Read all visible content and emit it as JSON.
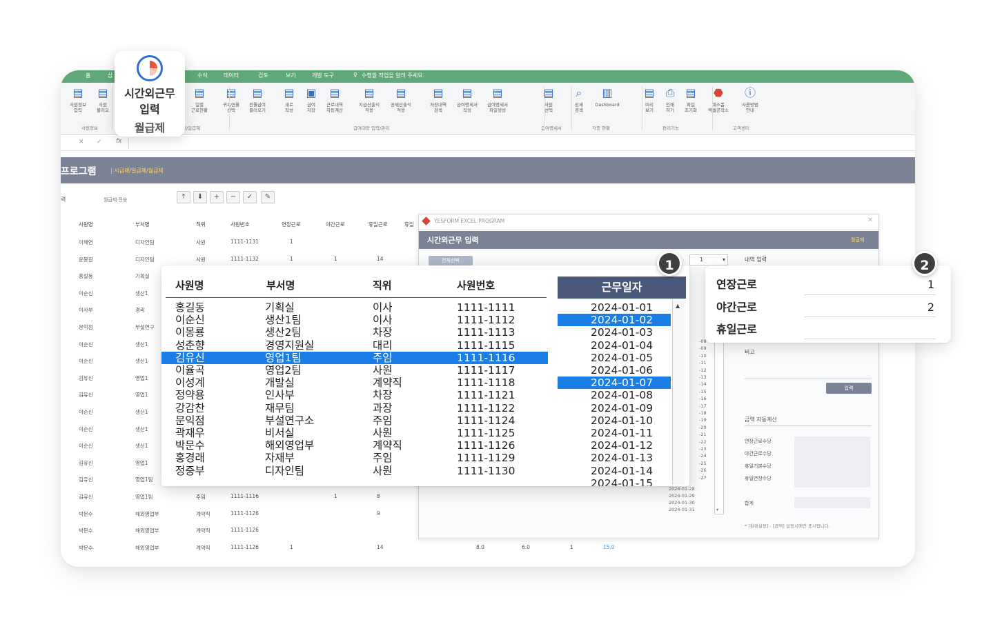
{
  "menu": {
    "items": [
      "홈",
      "삽",
      "수식",
      "데이터",
      "검토",
      "보기",
      "개발 도구"
    ],
    "search_hint": "수행할 작업을 알려 주세요."
  },
  "ribbon": {
    "buttons": [
      {
        "label": "사원정보\n입력",
        "icon": "people-icon"
      },
      {
        "label": "사원\n불러오",
        "icon": "people-load-icon"
      },
      {
        "label": "보\n",
        "icon": "doc-icon"
      },
      {
        "label": "일별\n근로현황",
        "icon": "calendar-icon"
      },
      {
        "label": "귀속연월\n선택",
        "icon": "calendar-select-icon"
      },
      {
        "label": "전월급여\n불러오기",
        "icon": "load-icon"
      },
      {
        "label": "새로\n작성",
        "icon": "new-doc-icon"
      },
      {
        "label": "급여\n저장",
        "icon": "save-icon"
      },
      {
        "label": "근로내역\n자동계산",
        "icon": "table-icon"
      },
      {
        "label": "지급산출식\n적용",
        "icon": "formula-icon"
      },
      {
        "label": "공제산출식\n적용",
        "icon": "formula2-icon"
      },
      {
        "label": "저장내역\n검색",
        "icon": "search-doc-icon"
      },
      {
        "label": "급여명세서\n작성",
        "icon": "edit-doc-icon"
      },
      {
        "label": "급여명세서\n파일생성",
        "icon": "file-gen-icon"
      },
      {
        "label": "사원\n선택",
        "icon": "user-select-icon"
      },
      {
        "label": "상세\n검색",
        "icon": "search-icon"
      },
      {
        "label": "Dashboard",
        "icon": "chart-icon"
      },
      {
        "label": "미리\n보기",
        "icon": "preview-icon"
      },
      {
        "label": "인쇄\n하기",
        "icon": "print-icon"
      },
      {
        "label": "파일\n초기화",
        "icon": "reset-icon"
      },
      {
        "label": "예스폼\n엑셀공작소",
        "icon": "yesform-icon"
      },
      {
        "label": "사용방법\n안내",
        "icon": "info-icon"
      }
    ],
    "groups": [
      "사원정보",
      "제/일급제",
      "급여대장 입력/관리",
      "급여명세서",
      "각종 현황",
      "편리기능",
      "고객센터"
    ]
  },
  "floating_card": {
    "line1": "시간외근무",
    "line2": "입력",
    "line3": "월급제"
  },
  "formula_bar": {
    "fx": "fx"
  },
  "program": {
    "title": "프로그램",
    "breadcrumb": "시급제/일급제/월급제",
    "sub_label_a": "력",
    "sub_label_b": "월급제 전용"
  },
  "sheet": {
    "headers": [
      "사원명",
      "부서명",
      "직위",
      "사원번호",
      "연장근로",
      "야간근로",
      "휴일근로",
      "휴일"
    ],
    "rows": [
      [
        "이채연",
        "디자인팀",
        "사원",
        "1111-1131",
        "1",
        "",
        ""
      ],
      [
        "윤봉길",
        "디자인팀",
        "사원",
        "1111-1132",
        "1",
        "1",
        "14"
      ],
      [
        "홍길동",
        "기획실",
        "",
        "",
        "",
        "",
        ""
      ],
      [
        "이순신",
        "생산1",
        "",
        "",
        "",
        "",
        ""
      ],
      [
        "이사부",
        "경리",
        "",
        "",
        "",
        "",
        ""
      ],
      [
        "문익점",
        "부설연구",
        "",
        "",
        "",
        "",
        ""
      ],
      [
        "이순신",
        "생산1",
        "",
        "",
        "",
        "",
        ""
      ],
      [
        "이순신",
        "생산1",
        "",
        "",
        "",
        "",
        ""
      ],
      [
        "김유신",
        "영업1",
        "",
        "",
        "",
        "",
        ""
      ],
      [
        "김유신",
        "영업1",
        "",
        "",
        "",
        "",
        ""
      ],
      [
        "이순신",
        "생산1",
        "",
        "",
        "",
        "",
        ""
      ],
      [
        "이순신",
        "생산1",
        "",
        "",
        "",
        "",
        ""
      ],
      [
        "이순신",
        "생산1",
        "",
        "",
        "",
        "",
        ""
      ],
      [
        "김유신",
        "영업1",
        "",
        "",
        "",
        "",
        ""
      ],
      [
        "김유신",
        "영업1팀",
        "",
        "",
        "",
        "",
        ""
      ],
      [
        "김유신",
        "영업1팀",
        "주임",
        "1111-1116",
        "",
        "1",
        "8"
      ],
      [
        "박문수",
        "해외영업부",
        "계약직",
        "1111-1126",
        "",
        "",
        "9"
      ],
      [
        "박문수",
        "해외영업부",
        "계약직",
        "1111-1126",
        "",
        "",
        ""
      ],
      [
        "박문수",
        "해외영업부",
        "계약직",
        "1111-1126",
        "1",
        "",
        "14"
      ]
    ],
    "last_row_extra": [
      "8.0",
      "6.0",
      "1",
      "15.0"
    ]
  },
  "dialog": {
    "app_name": "YESFORM EXCEL PROGRAM",
    "title": "시간외근무 입력",
    "mode": "월급제",
    "select_all": "전체선택",
    "input_header": "내역 입력",
    "remark_label": "비고",
    "submit_label": "입력",
    "auto_calc_label": "금액 자동계산",
    "calc_items": [
      "연장근로수당",
      "야간근로수당",
      "휴일기본수당",
      "휴일연장수당"
    ],
    "total_label": "합계",
    "footnote": "* [환경설정] - [금액] 설정시에만 표시됩니다.",
    "small_dates_tail": [
      "2024-01-28",
      "2024-01-29",
      "2024-01-30",
      "2024-01-31"
    ],
    "small_day_nums": [
      "-08",
      "-09",
      "-10",
      "-11",
      "-12",
      "-13",
      "-14",
      "-15",
      "-16",
      "-17",
      "-18",
      "-19",
      "-20",
      "-21",
      "-22",
      "-23",
      "-24",
      "-25",
      "-26",
      "-27"
    ],
    "month_value": "1"
  },
  "popup": {
    "headers": [
      "사원명",
      "부서명",
      "직위",
      "사원번호"
    ],
    "date_header": "근무일자",
    "rows": [
      {
        "name": "홍길동",
        "dept": "기획실",
        "pos": "이사",
        "id": "1111-1111"
      },
      {
        "name": "이순신",
        "dept": "생산1팀",
        "pos": "이사",
        "id": "1111-1112"
      },
      {
        "name": "이몽룡",
        "dept": "생산2팀",
        "pos": "차장",
        "id": "1111-1113"
      },
      {
        "name": "성춘향",
        "dept": "경영지원실",
        "pos": "대리",
        "id": "1111-1115"
      },
      {
        "name": "김유신",
        "dept": "영업1팀",
        "pos": "주임",
        "id": "1111-1116"
      },
      {
        "name": "이율곡",
        "dept": "영업2팀",
        "pos": "사원",
        "id": "1111-1117"
      },
      {
        "name": "이성계",
        "dept": "개발실",
        "pos": "계약직",
        "id": "1111-1118"
      },
      {
        "name": "정약용",
        "dept": "인사부",
        "pos": "차장",
        "id": "1111-1121"
      },
      {
        "name": "강감찬",
        "dept": "재무팀",
        "pos": "과장",
        "id": "1111-1122"
      },
      {
        "name": "문익점",
        "dept": "부설연구소",
        "pos": "주임",
        "id": "1111-1124"
      },
      {
        "name": "곽재우",
        "dept": "비서실",
        "pos": "사원",
        "id": "1111-1125"
      },
      {
        "name": "박문수",
        "dept": "해외영업부",
        "pos": "계약직",
        "id": "1111-1126"
      },
      {
        "name": "홍경래",
        "dept": "자재부",
        "pos": "주임",
        "id": "1111-1129"
      },
      {
        "name": "정중부",
        "dept": "디자인팀",
        "pos": "사원",
        "id": "1111-1130"
      }
    ],
    "selected_row": 4,
    "dates": [
      "2024-01-01",
      "2024-01-02",
      "2024-01-03",
      "2024-01-04",
      "2024-01-05",
      "2024-01-06",
      "2024-01-07",
      "2024-01-08",
      "2024-01-09",
      "2024-01-10",
      "2024-01-11",
      "2024-01-12",
      "2024-01-13",
      "2024-01-14",
      "2024-01-15"
    ],
    "selected_dates": [
      1,
      6
    ]
  },
  "badges": {
    "one": "1",
    "two": "2"
  },
  "card": {
    "items": [
      {
        "label": "연장근로",
        "value": "1"
      },
      {
        "label": "야간근로",
        "value": "2"
      },
      {
        "label": "휴일근로",
        "value": ""
      }
    ]
  },
  "colors": {
    "accent": "#1a7ee6",
    "header": "#7d8396",
    "menubar": "#5fa877",
    "date_header": "#48577a"
  }
}
